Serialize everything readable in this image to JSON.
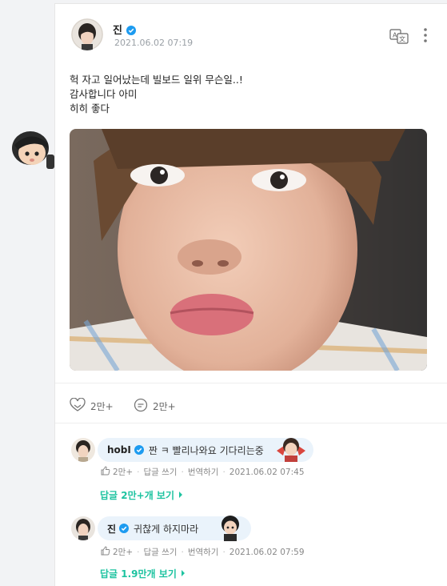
{
  "post": {
    "author": "진",
    "timestamp": "2021.06.02 07:19",
    "lines": [
      "헉 자고 일어났는데 빌보드 일위 무슨일..!",
      "감사합니다 아미",
      "히히 좋다"
    ],
    "likes": "2만+",
    "comments": "2만+"
  },
  "comments": [
    {
      "name": "hobI",
      "text": "짠 ㅋ 빨리나와요 기다리는중",
      "likes": "2만+",
      "reply_label": "답글 쓰기",
      "translate_label": "번역하기",
      "timestamp": "2021.06.02 07:45",
      "replies_link": "답글 2만+개 보기"
    },
    {
      "name": "진",
      "text": "귀찮게 하지마라",
      "likes": "2만+",
      "reply_label": "답글 쓰기",
      "translate_label": "번역하기",
      "timestamp": "2021.06.02 07:59",
      "replies_link": "답글 1.9만개 보기"
    }
  ],
  "colors": {
    "accent": "#1ec3a0",
    "verified": "#1d9bf0",
    "bubble": "#eaf3fb"
  },
  "icons": [
    "verified-badge-icon",
    "translate-icon",
    "more-vertical-icon",
    "like-icon",
    "comment-icon",
    "thumb-up-icon",
    "chevron-right-icon"
  ]
}
